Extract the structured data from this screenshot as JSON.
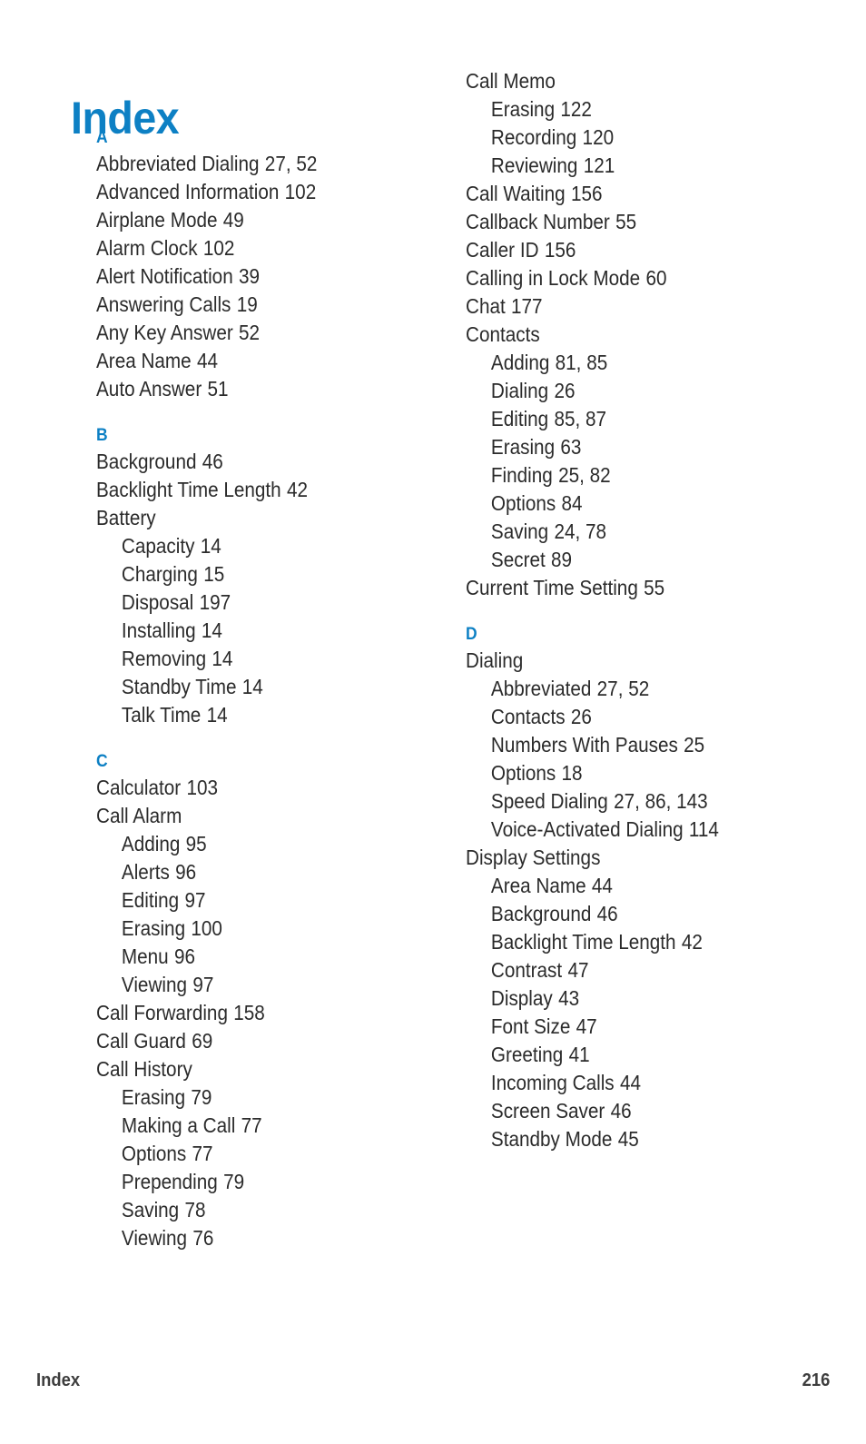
{
  "page": {
    "title": "Index",
    "title_color": "#0d80c4",
    "text_color": "#2b2b2b",
    "background": "#ffffff"
  },
  "footer": {
    "label": "Index",
    "page_number": "216"
  },
  "columns": [
    {
      "id": "left",
      "sections": [
        {
          "letter": "A",
          "entries": [
            {
              "level": 1,
              "text": "Abbreviated Dialing",
              "pages": "27, 52"
            },
            {
              "level": 1,
              "text": "Advanced Information",
              "pages": "102"
            },
            {
              "level": 1,
              "text": "Airplane Mode",
              "pages": "49"
            },
            {
              "level": 1,
              "text": "Alarm Clock",
              "pages": "102"
            },
            {
              "level": 1,
              "text": "Alert Notification",
              "pages": "39"
            },
            {
              "level": 1,
              "text": "Answering Calls",
              "pages": "19"
            },
            {
              "level": 1,
              "text": "Any Key Answer",
              "pages": "52"
            },
            {
              "level": 1,
              "text": "Area Name",
              "pages": "44"
            },
            {
              "level": 1,
              "text": "Auto Answer",
              "pages": "51"
            }
          ]
        },
        {
          "letter": "B",
          "entries": [
            {
              "level": 1,
              "text": "Background",
              "pages": "46"
            },
            {
              "level": 1,
              "text": "Backlight Time Length",
              "pages": "42"
            },
            {
              "level": 1,
              "text": "Battery",
              "pages": ""
            },
            {
              "level": 2,
              "text": "Capacity",
              "pages": "14"
            },
            {
              "level": 2,
              "text": "Charging",
              "pages": "15"
            },
            {
              "level": 2,
              "text": "Disposal",
              "pages": "197"
            },
            {
              "level": 2,
              "text": "Installing",
              "pages": "14"
            },
            {
              "level": 2,
              "text": "Removing",
              "pages": "14"
            },
            {
              "level": 2,
              "text": "Standby Time",
              "pages": "14"
            },
            {
              "level": 2,
              "text": "Talk Time",
              "pages": "14"
            }
          ]
        },
        {
          "letter": "C",
          "entries": [
            {
              "level": 1,
              "text": "Calculator",
              "pages": "103"
            },
            {
              "level": 1,
              "text": "Call Alarm",
              "pages": ""
            },
            {
              "level": 2,
              "text": "Adding",
              "pages": "95"
            },
            {
              "level": 2,
              "text": "Alerts",
              "pages": "96"
            },
            {
              "level": 2,
              "text": "Editing",
              "pages": "97"
            },
            {
              "level": 2,
              "text": "Erasing",
              "pages": "100"
            },
            {
              "level": 2,
              "text": "Menu",
              "pages": "96"
            },
            {
              "level": 2,
              "text": "Viewing",
              "pages": "97"
            },
            {
              "level": 1,
              "text": "Call Forwarding",
              "pages": "158"
            },
            {
              "level": 1,
              "text": "Call Guard",
              "pages": "69"
            },
            {
              "level": 1,
              "text": "Call History",
              "pages": ""
            },
            {
              "level": 2,
              "text": "Erasing",
              "pages": "79"
            },
            {
              "level": 2,
              "text": "Making a Call",
              "pages": "77"
            },
            {
              "level": 2,
              "text": "Options",
              "pages": "77"
            },
            {
              "level": 2,
              "text": "Prepending",
              "pages": "79"
            },
            {
              "level": 2,
              "text": "Saving",
              "pages": "78"
            },
            {
              "level": 2,
              "text": "Viewing",
              "pages": "76"
            }
          ]
        }
      ]
    },
    {
      "id": "right",
      "sections": [
        {
          "letter": "",
          "entries": [
            {
              "level": 1,
              "text": "Call Memo",
              "pages": ""
            },
            {
              "level": 2,
              "text": "Erasing",
              "pages": "122"
            },
            {
              "level": 2,
              "text": "Recording",
              "pages": "120"
            },
            {
              "level": 2,
              "text": "Reviewing",
              "pages": "121"
            },
            {
              "level": 1,
              "text": "Call Waiting",
              "pages": "156"
            },
            {
              "level": 1,
              "text": "Callback Number",
              "pages": "55"
            },
            {
              "level": 1,
              "text": "Caller ID",
              "pages": "156"
            },
            {
              "level": 1,
              "text": "Calling in Lock Mode",
              "pages": "60"
            },
            {
              "level": 1,
              "text": "Chat",
              "pages": "177"
            },
            {
              "level": 1,
              "text": "Contacts",
              "pages": ""
            },
            {
              "level": 2,
              "text": "Adding",
              "pages": "81, 85"
            },
            {
              "level": 2,
              "text": "Dialing",
              "pages": "26"
            },
            {
              "level": 2,
              "text": "Editing",
              "pages": "85, 87"
            },
            {
              "level": 2,
              "text": "Erasing",
              "pages": "63"
            },
            {
              "level": 2,
              "text": "Finding",
              "pages": "25, 82"
            },
            {
              "level": 2,
              "text": "Options",
              "pages": "84"
            },
            {
              "level": 2,
              "text": "Saving",
              "pages": "24, 78"
            },
            {
              "level": 2,
              "text": "Secret",
              "pages": "89"
            },
            {
              "level": 1,
              "text": "Current Time Setting",
              "pages": "55"
            }
          ]
        },
        {
          "letter": "D",
          "entries": [
            {
              "level": 1,
              "text": "Dialing",
              "pages": ""
            },
            {
              "level": 2,
              "text": "Abbreviated",
              "pages": "27, 52"
            },
            {
              "level": 2,
              "text": "Contacts",
              "pages": "26"
            },
            {
              "level": 2,
              "text": "Numbers With Pauses",
              "pages": "25"
            },
            {
              "level": 2,
              "text": "Options",
              "pages": "18"
            },
            {
              "level": 2,
              "text": "Speed Dialing",
              "pages": "27, 86, 143"
            },
            {
              "level": 2,
              "text": "Voice-Activated Dialing",
              "pages": "114"
            },
            {
              "level": 1,
              "text": "Display Settings",
              "pages": ""
            },
            {
              "level": 2,
              "text": "Area Name",
              "pages": "44"
            },
            {
              "level": 2,
              "text": "Background",
              "pages": "46"
            },
            {
              "level": 2,
              "text": "Backlight Time Length",
              "pages": "42"
            },
            {
              "level": 2,
              "text": "Contrast",
              "pages": "47"
            },
            {
              "level": 2,
              "text": "Display",
              "pages": "43"
            },
            {
              "level": 2,
              "text": "Font Size",
              "pages": "47"
            },
            {
              "level": 2,
              "text": "Greeting",
              "pages": "41"
            },
            {
              "level": 2,
              "text": "Incoming Calls",
              "pages": "44"
            },
            {
              "level": 2,
              "text": "Screen Saver",
              "pages": "46"
            },
            {
              "level": 2,
              "text": "Standby Mode",
              "pages": "45"
            }
          ]
        }
      ]
    }
  ]
}
